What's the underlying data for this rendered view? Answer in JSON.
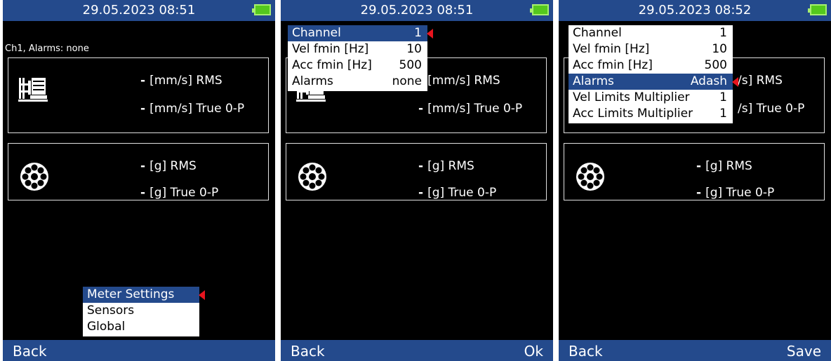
{
  "screens": [
    {
      "datetime": "29.05.2023 08:51",
      "info": "Ch1, Alarms: none",
      "vel_rms": "[mm/s] RMS",
      "vel_peak": "[mm/s] True 0-P",
      "acc_rms": "[g] RMS",
      "acc_peak": "[g] True 0-P",
      "dash": "-",
      "menu": [
        "Meter Settings",
        "Sensors",
        "Global"
      ],
      "back": "Back"
    },
    {
      "datetime": "29.05.2023 08:51",
      "vel_rms": "[mm/s] RMS",
      "vel_peak": "[mm/s] True 0-P",
      "acc_rms": "[g] RMS",
      "acc_peak": "[g] True 0-P",
      "dash": "-",
      "menu": [
        {
          "label": "Channel",
          "value": "1"
        },
        {
          "label": "Vel fmin [Hz]",
          "value": "10"
        },
        {
          "label": "Acc fmin [Hz]",
          "value": "500"
        },
        {
          "label": "Alarms",
          "value": "none"
        }
      ],
      "back": "Back",
      "ok": "Ok"
    },
    {
      "datetime": "29.05.2023 08:52",
      "vel_rms": "/s] RMS",
      "vel_peak": "/s] True 0-P",
      "acc_rms": "[g] RMS",
      "acc_peak": "[g] True 0-P",
      "dash": "-",
      "menu": [
        {
          "label": "Channel",
          "value": "1"
        },
        {
          "label": "Vel fmin [Hz]",
          "value": "10"
        },
        {
          "label": "Acc fmin [Hz]",
          "value": "500"
        },
        {
          "label": "Alarms",
          "value": "Adash"
        },
        {
          "label": "Vel Limits Multiplier",
          "value": "1"
        },
        {
          "label": "Acc Limits Multiplier",
          "value": "1"
        }
      ],
      "back": "Back",
      "save": "Save"
    }
  ],
  "colors": {
    "bar": "#244a8c",
    "battery": "#54c81d",
    "pointer": "#e8141e"
  },
  "icons": [
    "battery-icon",
    "machine-icon",
    "bearing-icon",
    "menu-pointer-icon"
  ]
}
